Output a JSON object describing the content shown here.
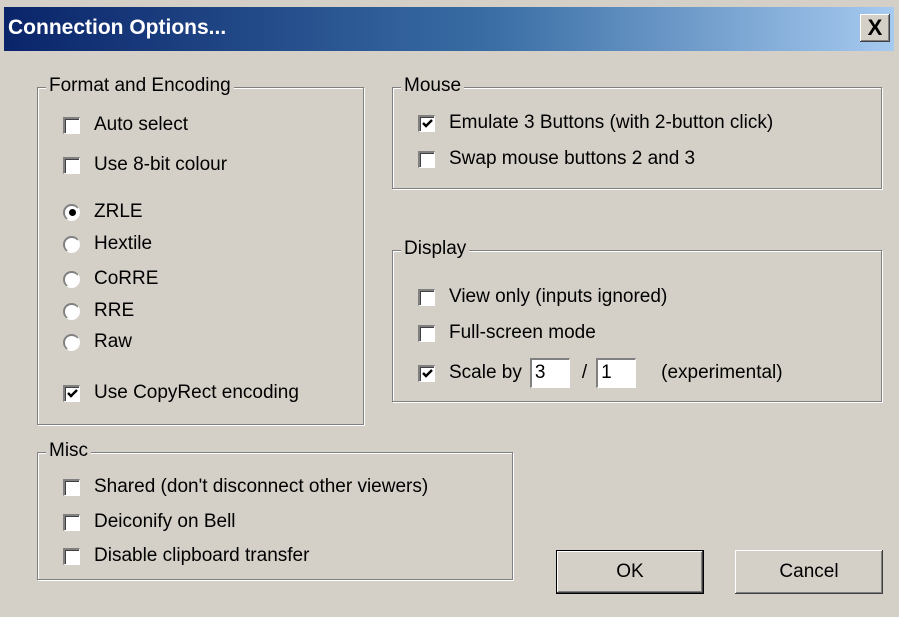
{
  "window": {
    "title": "Connection Options...",
    "close_label": "X"
  },
  "format_encoding": {
    "label": "Format and Encoding",
    "auto_select": {
      "label": "Auto select",
      "checked": false
    },
    "use_8bit": {
      "label": "Use 8-bit colour",
      "checked": false
    },
    "encodings": [
      {
        "label": "ZRLE",
        "selected": true
      },
      {
        "label": "Hextile",
        "selected": false
      },
      {
        "label": "CoRRE",
        "selected": false
      },
      {
        "label": "RRE",
        "selected": false
      },
      {
        "label": "Raw",
        "selected": false
      }
    ],
    "copyrect": {
      "label": "Use CopyRect encoding",
      "checked": true
    }
  },
  "mouse": {
    "label": "Mouse",
    "emulate3": {
      "label": "Emulate 3 Buttons (with 2-button click)",
      "checked": true
    },
    "swap": {
      "label": "Swap mouse buttons 2 and 3",
      "checked": false
    }
  },
  "display": {
    "label": "Display",
    "view_only": {
      "label": "View only (inputs ignored)",
      "checked": false
    },
    "fullscreen": {
      "label": "Full-screen mode",
      "checked": false
    },
    "scale": {
      "label": "Scale by",
      "checked": true,
      "numerator": "3",
      "separator": "/",
      "denominator": "1",
      "note": "(experimental)"
    }
  },
  "misc": {
    "label": "Misc",
    "shared": {
      "label": "Shared (don't disconnect other viewers)",
      "checked": false
    },
    "deiconify": {
      "label": "Deiconify on Bell",
      "checked": false
    },
    "clipboard": {
      "label": "Disable clipboard transfer",
      "checked": false
    }
  },
  "buttons": {
    "ok": "OK",
    "cancel": "Cancel"
  }
}
